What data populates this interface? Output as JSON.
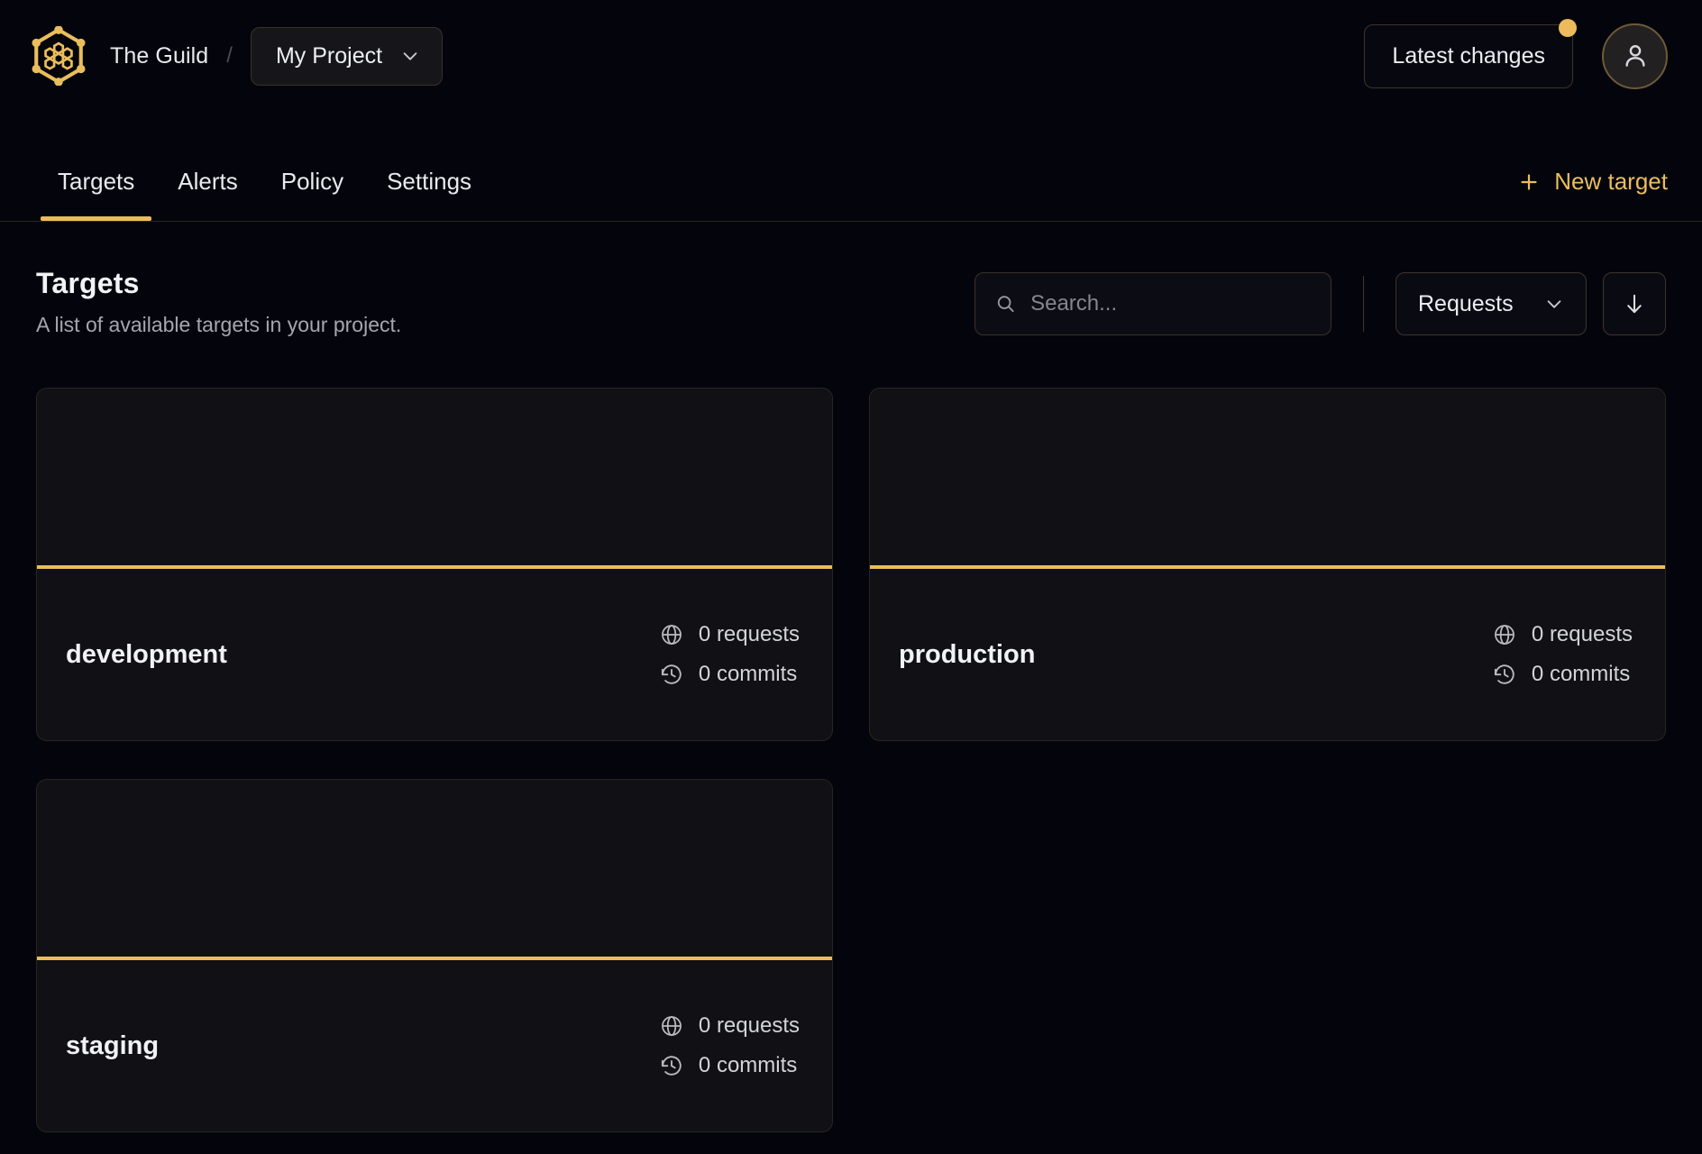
{
  "header": {
    "logo_icon": "hive-hexagon-logo",
    "org_name": "The Guild",
    "separator": "/",
    "project_name": "My Project",
    "project_chevron_icon": "chevron-down-icon",
    "latest_changes_label": "Latest changes",
    "notification_dot": true,
    "avatar_icon": "user-icon"
  },
  "nav": {
    "tabs": [
      {
        "label": "Targets",
        "active": true
      },
      {
        "label": "Alerts",
        "active": false
      },
      {
        "label": "Policy",
        "active": false
      },
      {
        "label": "Settings",
        "active": false
      }
    ],
    "new_target_label": "New target",
    "new_target_icon": "plus-icon"
  },
  "page": {
    "title": "Targets",
    "subtitle": "A list of available targets in your project."
  },
  "toolbar": {
    "search_placeholder": "Search...",
    "search_value": "",
    "search_icon": "search-icon",
    "sort_select_label": "Requests",
    "sort_select_chevron_icon": "chevron-down-icon",
    "sort_direction_icon": "arrow-down-icon"
  },
  "targets": [
    {
      "name": "development",
      "requests_label": "0 requests",
      "commits_label": "0 commits",
      "requests_icon": "globe-icon",
      "commits_icon": "history-icon"
    },
    {
      "name": "production",
      "requests_label": "0 requests",
      "commits_label": "0 commits",
      "requests_icon": "globe-icon",
      "commits_icon": "history-icon"
    },
    {
      "name": "staging",
      "requests_label": "0 requests",
      "commits_label": "0 commits",
      "requests_icon": "globe-icon",
      "commits_icon": "history-icon"
    }
  ],
  "colors": {
    "accent": "#eabd5d",
    "page_background": "#04050c",
    "card_background": "#101015",
    "border": "#2a2420",
    "text_primary": "#f1f2f6",
    "text_muted": "#a6a7ae"
  }
}
